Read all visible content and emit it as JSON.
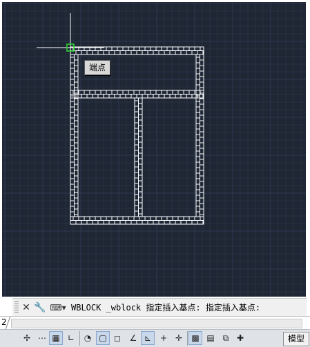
{
  "drawing": {
    "snap_tooltip": "端点",
    "colors": {
      "background": "#1f2735",
      "grid_minor": "#283244",
      "grid_major": "#2e3a4e",
      "linework": "#ffffff",
      "crosshair": "#ffffff",
      "snap_marker": "#2fdc2f"
    }
  },
  "command": {
    "close_icon": "close-icon",
    "options_icon": "wrench-icon",
    "history_icon": "command-history-icon",
    "text": "WBLOCK _wblock 指定插入基点: 指定插入基点:"
  },
  "layout_tabs": {
    "tab_number": "2"
  },
  "statusbar": {
    "buttons": [
      {
        "icon": "infer-constraints-icon",
        "glyph": "✢",
        "on": false
      },
      {
        "icon": "snap-mode-icon",
        "glyph": "⋯",
        "on": false
      },
      {
        "icon": "grid-display-icon",
        "glyph": "▦",
        "on": true
      },
      {
        "icon": "ortho-mode-icon",
        "glyph": "∟",
        "on": false
      },
      {
        "icon": "polar-tracking-icon",
        "glyph": "◔",
        "on": false
      },
      {
        "icon": "object-snap-icon",
        "glyph": "▢",
        "on": true
      },
      {
        "icon": "3d-object-snap-icon",
        "glyph": "◻",
        "on": false
      },
      {
        "icon": "object-snap-tracking-icon",
        "glyph": "∠",
        "on": false
      },
      {
        "icon": "dynamic-ucs-icon",
        "glyph": "⊾",
        "on": true
      },
      {
        "icon": "dynamic-input-icon",
        "glyph": "+",
        "on": false
      },
      {
        "icon": "lineweight-icon",
        "glyph": "✛",
        "on": false
      },
      {
        "icon": "transparency-icon",
        "glyph": "▩",
        "on": true
      },
      {
        "icon": "quick-properties-icon",
        "glyph": "▤",
        "on": false
      },
      {
        "icon": "selection-cycling-icon",
        "glyph": "⧉",
        "on": false
      },
      {
        "icon": "annotation-monitor-icon",
        "glyph": "✚",
        "on": false
      }
    ],
    "model_label": "模型"
  }
}
